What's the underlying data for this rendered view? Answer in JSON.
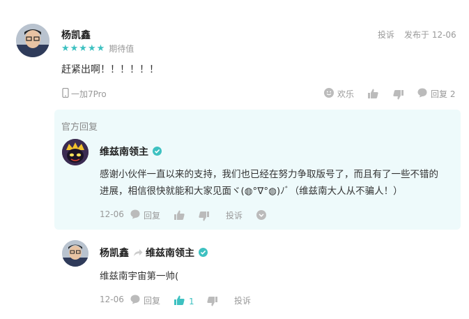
{
  "comment": {
    "author": "杨凯鑫",
    "rating_label": "期待值",
    "stars": 5,
    "report": "投诉",
    "published": "发布于 12-06",
    "text": "赶紧出啊！！！！！！",
    "device": "一加7Pro",
    "happy": "欢乐",
    "reply_label": "回复 2"
  },
  "official": {
    "section_title": "官方回复",
    "author": "维兹南领主",
    "text_line1": "感谢小伙伴一直以来的支持，我们也已经在努力争取版号了，而且有了一些不错的",
    "text_line2": "进展，相信很快就能和大家见面ヾ(◍°∇°◍)ﾉﾞ（维兹南大人从不骗人！）",
    "date": "12-06",
    "reply": "回复",
    "report": "投诉"
  },
  "subreply": {
    "author": "杨凯鑫",
    "to": "维兹南领主",
    "text": "维兹南宇宙第一帅(",
    "date": "12-06",
    "reply": "回复",
    "like_count": "1",
    "report": "投诉"
  },
  "colors": {
    "teal": "#3ec1c1",
    "panel": "#eefafb",
    "gray": "#999999"
  }
}
